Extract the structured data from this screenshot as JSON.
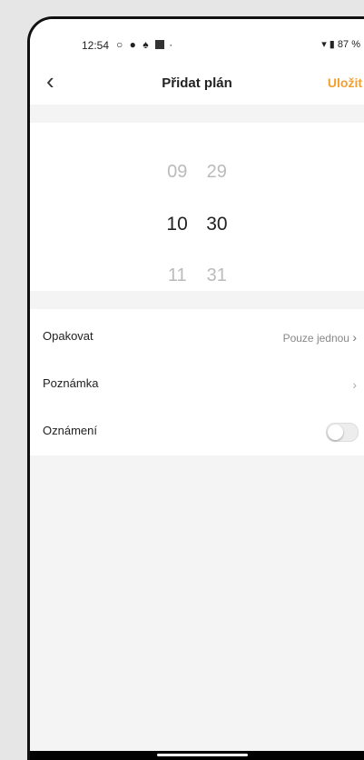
{
  "status_bar": {
    "time": "12:54",
    "battery": "87 %",
    "icons": [
      "circle-icon",
      "github-icon",
      "notification-icon",
      "square-icon",
      "dot-icon",
      "wifi-icon",
      "battery-icon"
    ]
  },
  "header": {
    "back_icon": "chevron-left-icon",
    "title": "Přidat plán",
    "save_label": "Uložit",
    "accent_color": "#f3a033"
  },
  "time_picker": {
    "above": {
      "hour": "09",
      "minute": "29"
    },
    "selected": {
      "hour": "10",
      "minute": "30"
    },
    "below": {
      "hour": "11",
      "minute": "31"
    }
  },
  "settings": {
    "repeat": {
      "label": "Opakovat",
      "value": "Pouze jednou"
    },
    "note": {
      "label": "Poznámka"
    },
    "notification": {
      "label": "Oznámení",
      "enabled": false
    }
  }
}
